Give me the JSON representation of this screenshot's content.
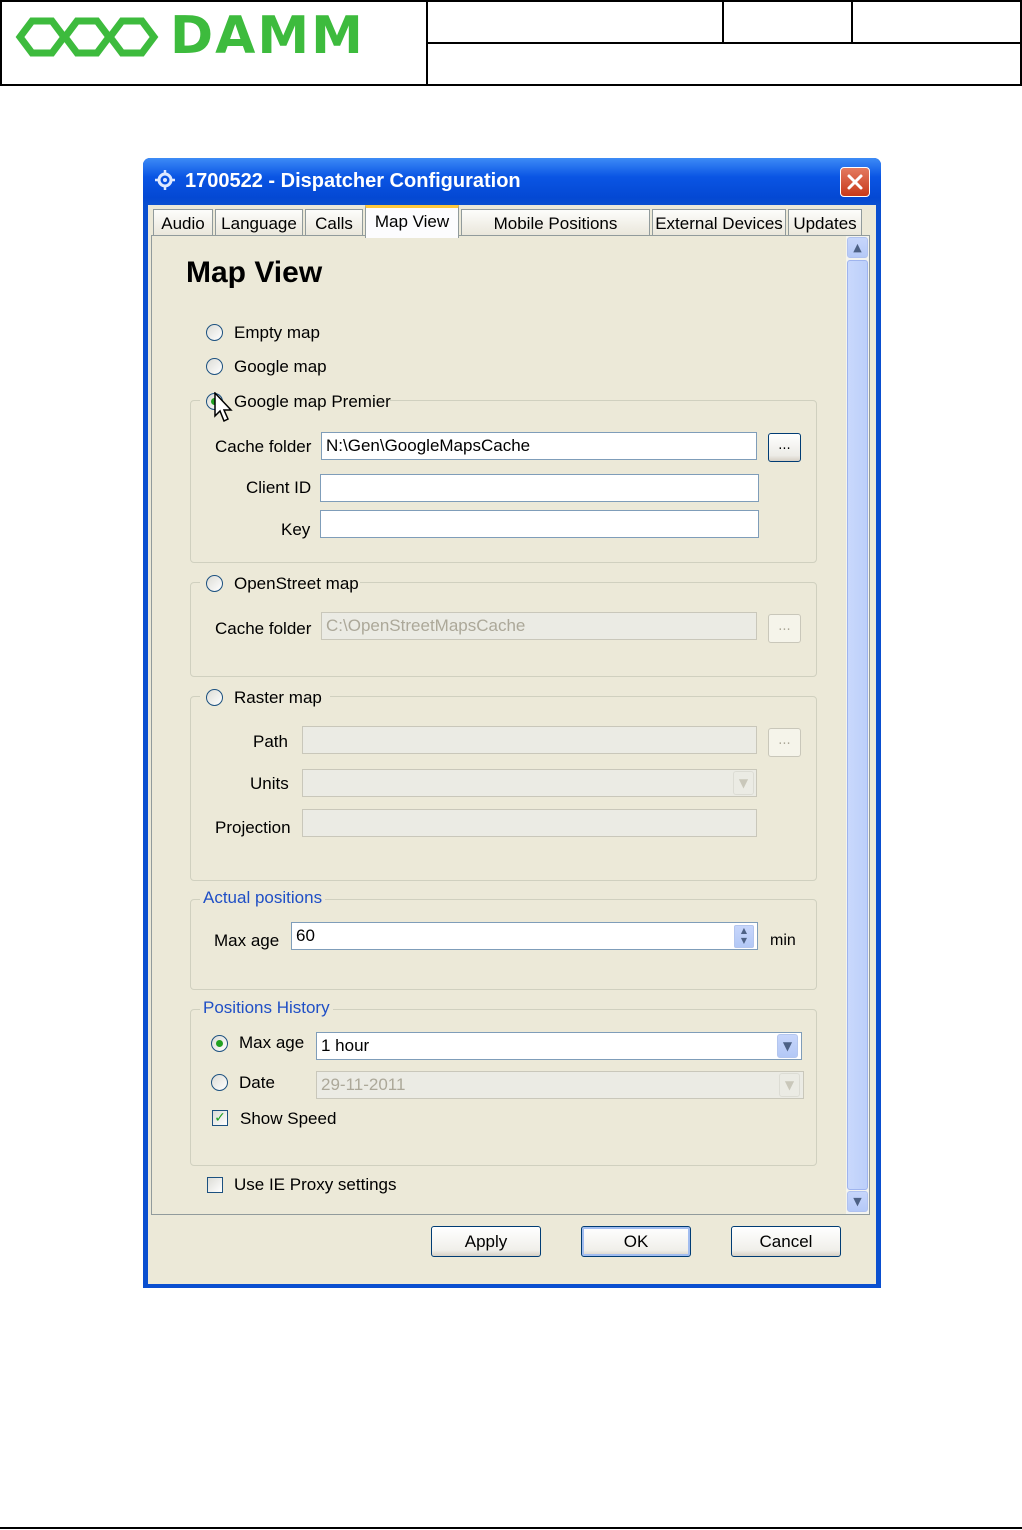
{
  "header": {
    "logo_text": "DAMM"
  },
  "window": {
    "title": "1700522 - Dispatcher Configuration",
    "close_icon": "close-icon",
    "app_icon": "gear-icon"
  },
  "tabs": [
    {
      "label": "Audio"
    },
    {
      "label": "Language"
    },
    {
      "label": "Calls"
    },
    {
      "label": "Map View",
      "active": true
    },
    {
      "label": "Mobile Positions Storage"
    },
    {
      "label": "External Devices"
    },
    {
      "label": "Updates"
    }
  ],
  "page": {
    "heading": "Map View",
    "map_options": {
      "empty_map": "Empty map",
      "google_map": "Google map",
      "google_map_premier": "Google map Premier",
      "openstreet_map": "OpenStreet map",
      "raster_map": "Raster map"
    },
    "google_premier": {
      "cache_folder_label": "Cache folder",
      "cache_folder_value": "N:\\Gen\\GoogleMapsCache",
      "client_id_label": "Client ID",
      "client_id_value": "",
      "key_label": "Key",
      "key_value": "",
      "browse_label": "..."
    },
    "openstreet": {
      "cache_folder_label": "Cache folder",
      "cache_folder_value": "C:\\OpenStreetMapsCache",
      "browse_label": "..."
    },
    "raster": {
      "path_label": "Path",
      "units_label": "Units",
      "projection_label": "Projection",
      "browse_label": "..."
    },
    "actual_positions": {
      "title": "Actual positions",
      "max_age_label": "Max age",
      "max_age_value": "60",
      "unit": "min"
    },
    "positions_history": {
      "title": "Positions History",
      "max_age_label": "Max age",
      "max_age_value": "1 hour",
      "date_label": "Date",
      "date_value": "29-11-2011",
      "show_speed_label": "Show Speed",
      "show_speed_checked": true
    },
    "use_ie_proxy_label": "Use IE Proxy settings"
  },
  "buttons": {
    "apply": "Apply",
    "ok": "OK",
    "cancel": "Cancel"
  },
  "colors": {
    "logo_green": "#3dbb3d",
    "title_blue": "#0a55e4",
    "group_title_blue": "#1f4fc6",
    "dialog_face": "#ece9d8"
  }
}
